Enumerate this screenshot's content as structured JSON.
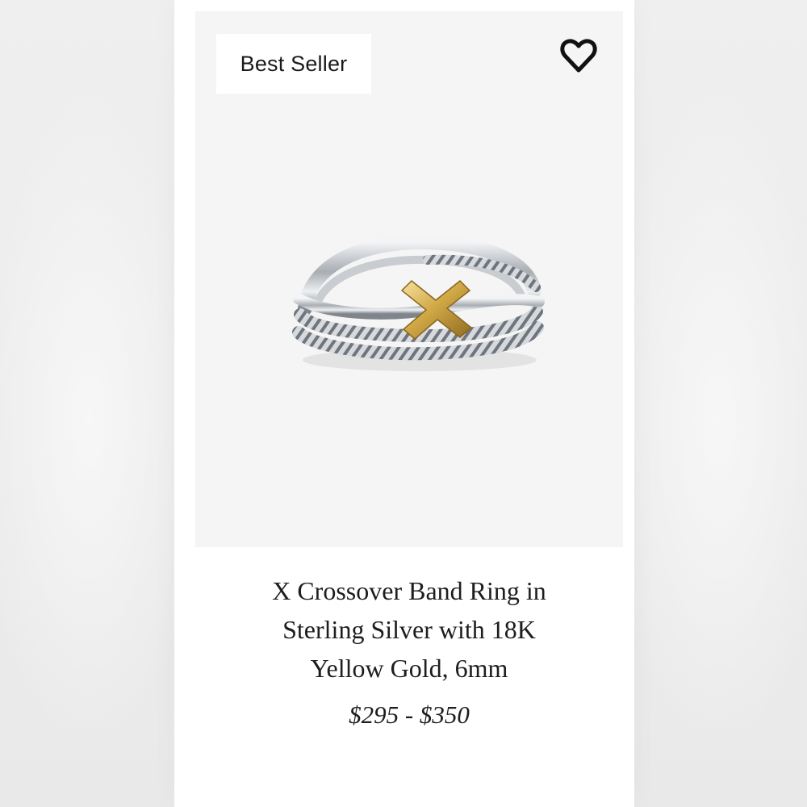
{
  "product": {
    "badge": "Best Seller",
    "favorite_icon": "heart-outline-icon",
    "image_alt": "ring-image",
    "title": "X Crossover Band Ring in\nSterling Silver with 18K\nYellow Gold, 6mm",
    "price": "$295 - $350"
  },
  "colors": {
    "page_bg": "#ececec",
    "card_bg": "#ffffff",
    "image_bg": "#f5f5f5",
    "text": "#1d1d1d",
    "gold": "#c9a54f",
    "silver": "#b9bcc1"
  }
}
